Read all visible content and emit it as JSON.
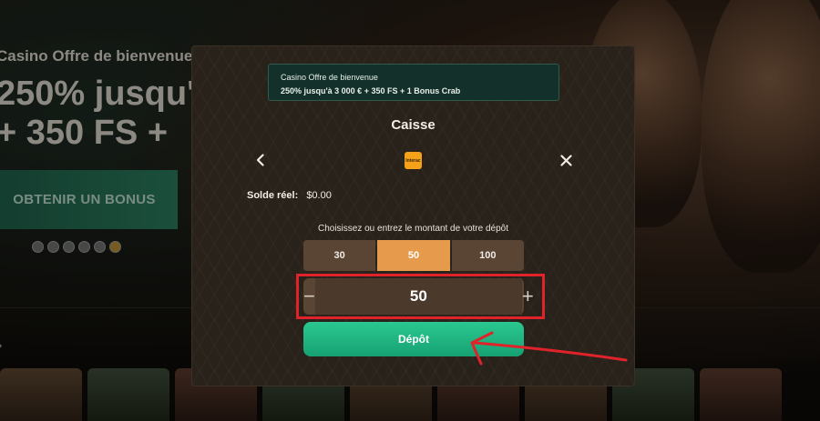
{
  "background": {
    "hero_title": "Casino Offre de bienvenue",
    "hero_line1": "250% jusqu'",
    "hero_line2": "+ 350 FS +",
    "bonus_button": "OBTENIR UN BONUS"
  },
  "modal": {
    "promo": {
      "title": "Casino Offre de bienvenue",
      "subtitle": "250% jusqu'à 3 000 € + 350 FS + 1 Bonus Crab"
    },
    "title": "Caisse",
    "back_icon": "chevron-left-icon",
    "close_icon": "close-icon",
    "payment_method_logo": "interac",
    "balance": {
      "label": "Solde réel:",
      "value": "$0.00"
    },
    "hint": "Choisissez ou entrez le montant de votre dépôt",
    "presets": [
      {
        "label": "30",
        "active": false
      },
      {
        "label": "50",
        "active": true
      },
      {
        "label": "100",
        "active": false
      }
    ],
    "amount": {
      "value": "50",
      "minus": "−",
      "plus": "+"
    },
    "deposit_button": "Dépôt"
  },
  "colors": {
    "accent_orange": "#e69a4c",
    "deposit_green": "#1fb37f",
    "highlight_red": "#e0232b"
  }
}
